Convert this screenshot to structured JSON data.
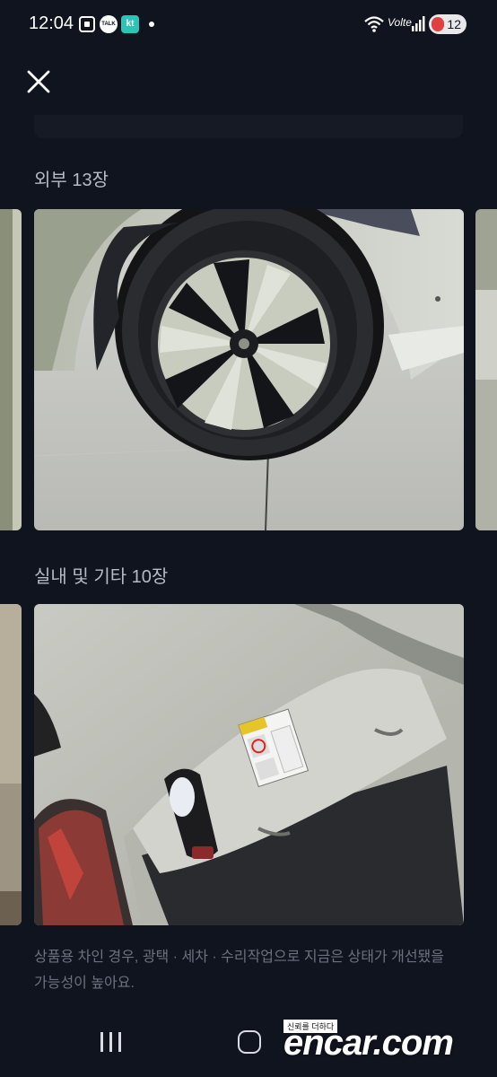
{
  "status_bar": {
    "time": "12:04",
    "icons": [
      "screenshot-icon",
      "kakaotalk-icon",
      "kt-icon"
    ],
    "talk_label": "TALK",
    "kt_label": "kt",
    "volte_label": "Volte",
    "battery": "12"
  },
  "sections": [
    {
      "title": "외부 13장"
    },
    {
      "title": "실내 및 기타 10장"
    }
  ],
  "disclaimer": "상품용 차인 경우, 광택 · 세차 · 수리작업으로 지금은 상태가 개선됐을 가능성이 높아요.",
  "watermark": {
    "tagline": "신뢰를 더하다",
    "brand": "encar.com"
  },
  "colors": {
    "background": "#10141e",
    "title": "#b6bac4",
    "disclaimer": "#6b717f"
  }
}
